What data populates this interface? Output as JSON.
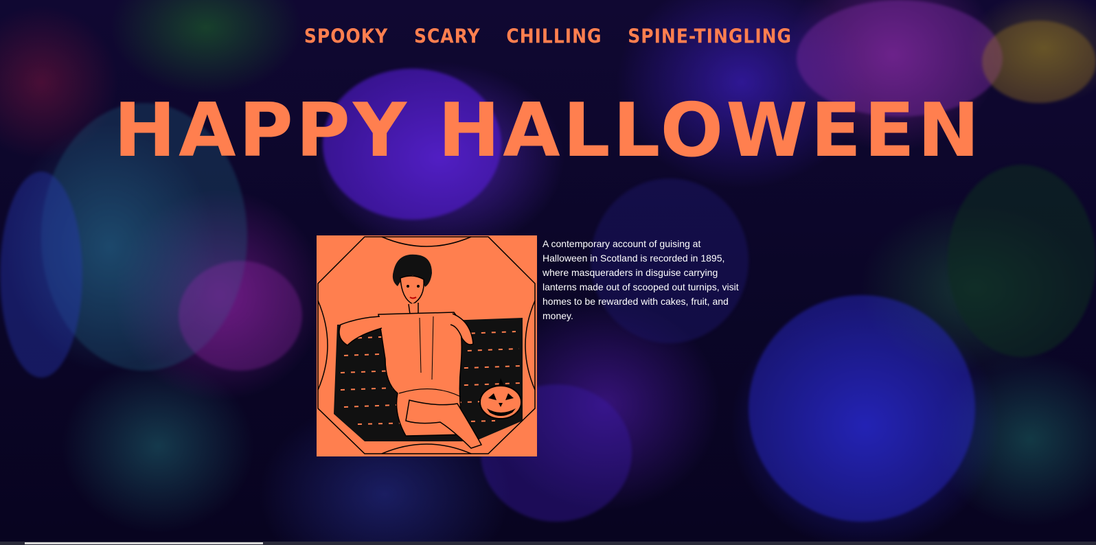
{
  "nav": {
    "items": [
      {
        "label": "SPOOKY"
      },
      {
        "label": "SCARY"
      },
      {
        "label": "CHILLING"
      },
      {
        "label": "SPINE-TINGLING"
      }
    ]
  },
  "hero": {
    "title": "HAPPY HALLOWEEN"
  },
  "content": {
    "paragraph": "A contemporary account of guising at Halloween in Scotland is recorded in 1895, where masqueraders in disguise carrying lanterns made out of scooped out turnips, visit homes to be rewarded with cakes, fruit, and money."
  },
  "colors": {
    "accent": "#ff7f4f",
    "text": "#ffffff",
    "background": "#0a0520"
  },
  "icons": {
    "illustration": "vintage-woman-with-jack-o-lantern-illustration"
  }
}
